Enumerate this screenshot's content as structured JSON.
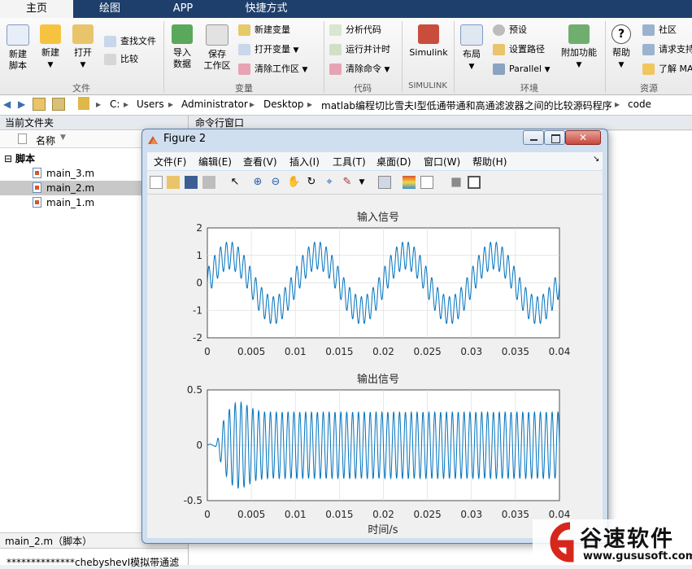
{
  "tabs": [
    "主页",
    "绘图",
    "APP",
    "快捷方式"
  ],
  "ribbon": {
    "file": {
      "new_script": "新建\n脚本",
      "new": "新建",
      "open": "打开",
      "find_files": "查找文件",
      "compare": "比较",
      "group": "文件"
    },
    "variable": {
      "import": "导入\n数据",
      "save_ws": "保存\n工作区",
      "new_var": "新建变量",
      "open_var": "打开变量",
      "clear_ws": "清除工作区",
      "group": "变量"
    },
    "code": {
      "analyze": "分析代码",
      "run_time": "运行并计时",
      "clear_cmd": "清除命令",
      "group": "代码"
    },
    "simulink": {
      "label": "Simulink",
      "group": "SIMULINK"
    },
    "env": {
      "layout": "布局",
      "prefs": "预设",
      "set_path": "设置路径",
      "parallel": "Parallel",
      "addons": "附加功能",
      "group": "环境"
    },
    "resources": {
      "help": "帮助",
      "community": "社区",
      "request": "请求支持",
      "learn": "了解 MA",
      "group": "资源"
    }
  },
  "address": [
    "C:",
    "Users",
    "Administrator",
    "Desktop",
    "matlab编程切比雪夫I型低通带通和高通滤波器之间的比较源码程序",
    "code"
  ],
  "left_panel": {
    "header": "当前文件夹",
    "col_name": "名称",
    "group": "脚本",
    "files": [
      "main_3.m",
      "main_2.m",
      "main_1.m"
    ],
    "selected_index": 1,
    "details_title": "main_2.m（脚本）",
    "details_text": "**************chebyshevI模拟带通滤"
  },
  "cmd_header": "命令行窗口",
  "figure": {
    "title": "Figure 2",
    "menus": [
      "文件(F)",
      "编辑(E)",
      "查看(V)",
      "插入(I)",
      "工具(T)",
      "桌面(D)",
      "窗口(W)",
      "帮助(H)"
    ]
  },
  "chart_data": [
    {
      "type": "line",
      "title": "输入信号",
      "xlabel": "",
      "ylabel": "",
      "xlim": [
        0,
        0.04
      ],
      "ylim": [
        -2,
        2
      ],
      "xticks": [
        "0",
        "0.005",
        "0.01",
        "0.015",
        "0.02",
        "0.025",
        "0.03",
        "0.035",
        "0.04"
      ],
      "yticks": [
        "2",
        "1",
        "0",
        "-1",
        "-2"
      ],
      "grid": true,
      "series": [
        {
          "color": "#0072bd",
          "components": [
            {
              "freq_hz": 100,
              "amp": 1.0
            },
            {
              "freq_hz": 1500,
              "amp": 0.5
            }
          ]
        }
      ]
    },
    {
      "type": "line",
      "title": "输出信号",
      "xlabel": "时间/s",
      "ylabel": "",
      "xlim": [
        0,
        0.04
      ],
      "ylim": [
        -0.5,
        0.5
      ],
      "xticks": [
        "0",
        "0.005",
        "0.01",
        "0.015",
        "0.02",
        "0.025",
        "0.03",
        "0.035",
        "0.04"
      ],
      "yticks": [
        "0.5",
        "0",
        "-0.5"
      ],
      "grid": true,
      "series": [
        {
          "color": "#0072bd",
          "freq_hz": 1500,
          "steady_amp": 0.3,
          "peak_amp": 0.42,
          "onset_s": 0.001
        }
      ]
    }
  ],
  "watermark": {
    "brand": "谷速软件",
    "url": "www.gususoft.com"
  }
}
